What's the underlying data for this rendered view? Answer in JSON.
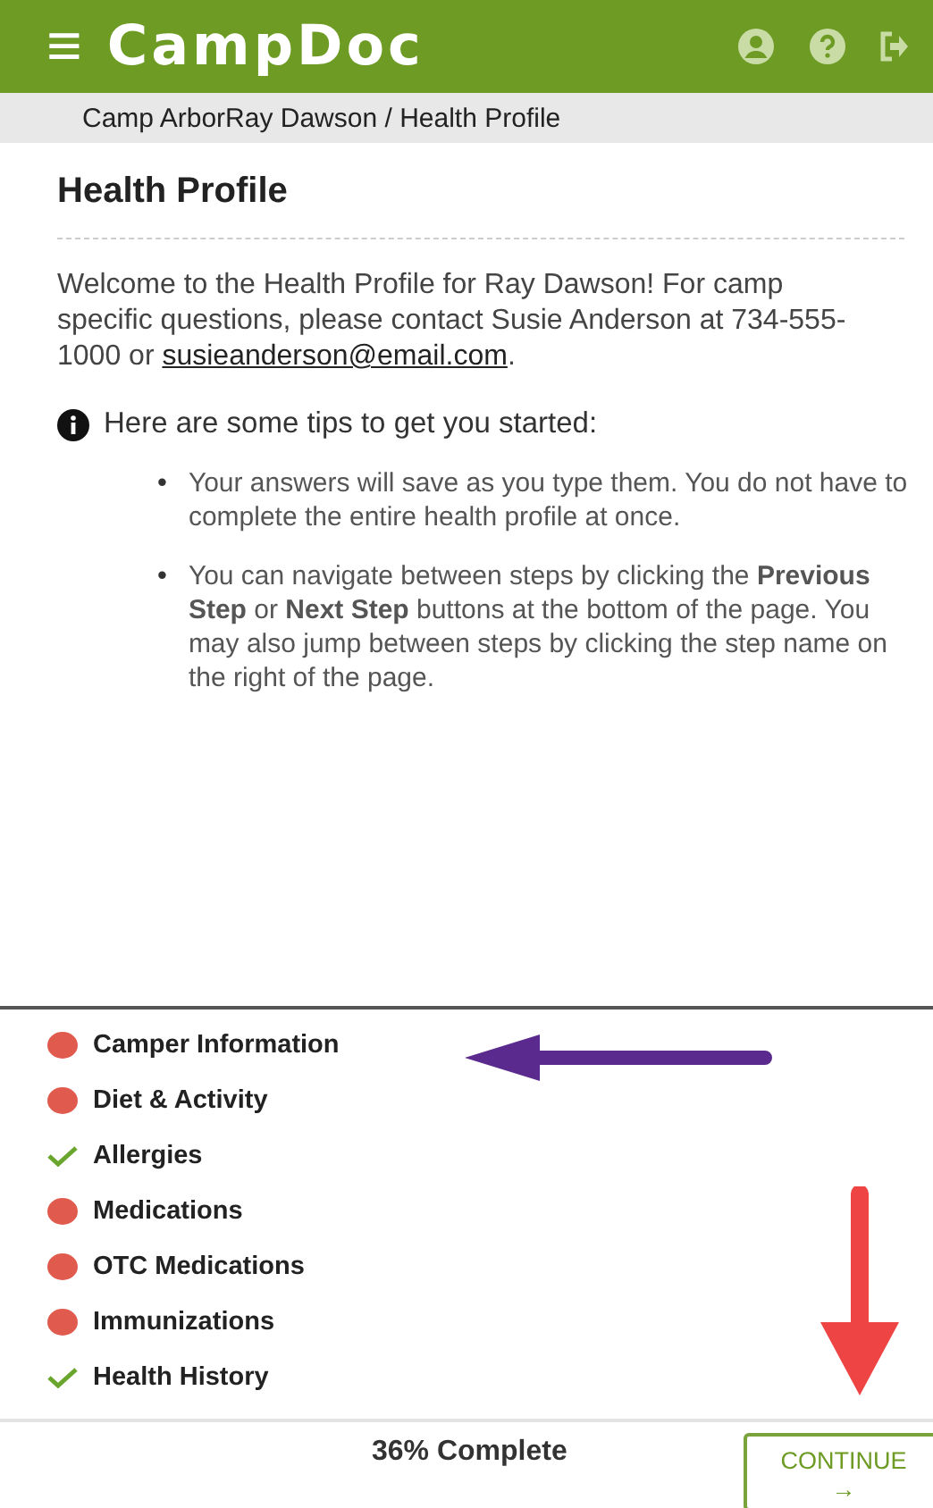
{
  "header": {
    "menu_icon": "≡",
    "logo": "CampDoc"
  },
  "breadcrumb": "Camp ArborRay Dawson / Health Profile",
  "title": "Health Profile",
  "intro": "Welcome to the Health Profile for Ray Dawson! For camp specific questions, please contact Susie Anderson at 734-555-1000 or ",
  "intro_link": "susieanderson@email.com",
  "intro_end": ".",
  "tips_heading": "Here are some tips to get you started:",
  "tip_bullet": "•",
  "tips": [
    "Your answers will save as you type them. You do not have to complete the entire health profile at once.",
    "You can navigate between steps by clicking the **Previous Step** or **Next Step** buttons at the bottom of the page. You may also jump between steps by clicking the step name on the right of the page."
  ],
  "steps": [
    {
      "label": "Camper Information",
      "complete": false
    },
    {
      "label": "Diet & Activity",
      "complete": false
    },
    {
      "label": "Allergies",
      "complete": true
    },
    {
      "label": "Medications",
      "complete": false
    },
    {
      "label": "OTC Medications",
      "complete": false
    },
    {
      "label": "Immunizations",
      "complete": false
    },
    {
      "label": "Health History",
      "complete": true
    }
  ],
  "progress": "36% Complete",
  "continue": {
    "label": "CONTINUE",
    "arrow": "→"
  }
}
